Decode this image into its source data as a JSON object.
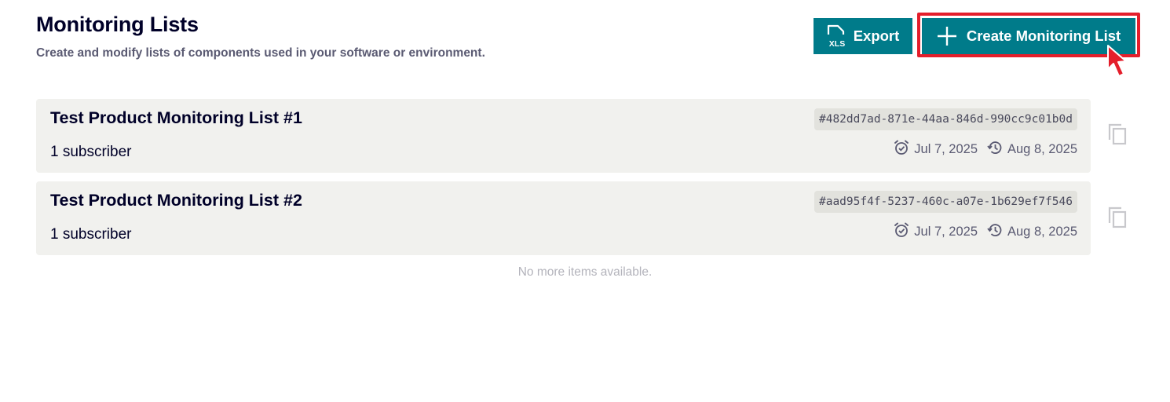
{
  "header": {
    "title": "Monitoring Lists",
    "subtitle": "Create and modify lists of components used in your software or environment."
  },
  "actions": {
    "export_label": "Export",
    "export_icon_text": "XLS",
    "create_label": "Create Monitoring List"
  },
  "lists": [
    {
      "title": "Test Product Monitoring List #1",
      "subscribers": "1 subscriber",
      "id": "#482dd7ad-871e-44aa-846d-990cc9c01b0d",
      "created": "Jul 7, 2025",
      "updated": "Aug 8, 2025"
    },
    {
      "title": "Test Product Monitoring List #2",
      "subscribers": "1 subscriber",
      "id": "#aad95f4f-5237-460c-a07e-1b629ef7f546",
      "created": "Jul 7, 2025",
      "updated": "Aug 8, 2025"
    }
  ],
  "footer": {
    "no_more": "No more items available."
  },
  "colors": {
    "accent": "#007b8a",
    "highlight": "#e41e2b",
    "card_bg": "#f1f1ee",
    "heading": "#000028"
  }
}
